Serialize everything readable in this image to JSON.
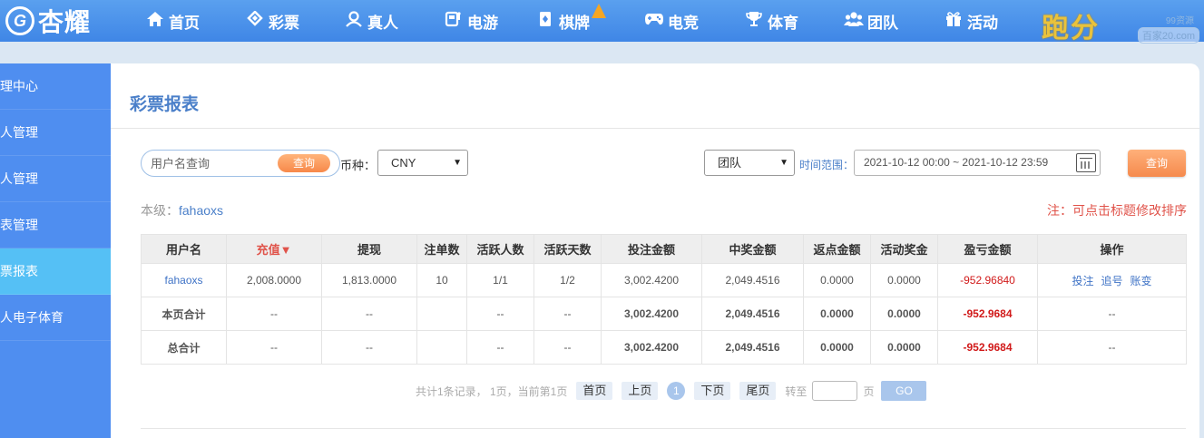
{
  "brand": {
    "logo_mark": "G",
    "logo_text": "杏耀",
    "promo_text": "跑分",
    "watermark_top": "99资源",
    "watermark_bottom": "百家20.com"
  },
  "nav": [
    {
      "label": "首页",
      "icon": "home-icon"
    },
    {
      "label": "彩票",
      "icon": "ticket-icon"
    },
    {
      "label": "真人",
      "icon": "person-icon"
    },
    {
      "label": "电游",
      "icon": "slot-machine-icon"
    },
    {
      "label": "棋牌",
      "icon": "card-icon"
    },
    {
      "label": "电竞",
      "icon": "gamepad-icon"
    },
    {
      "label": "体育",
      "icon": "trophy-icon"
    },
    {
      "label": "团队",
      "icon": "team-icon"
    },
    {
      "label": "活动",
      "icon": "gift-icon"
    }
  ],
  "sidebar": {
    "items": [
      {
        "label": "理中心"
      },
      {
        "label": "人管理"
      },
      {
        "label": "人管理"
      },
      {
        "label": "表管理"
      },
      {
        "label": "票报表"
      },
      {
        "label": "人电子体育"
      }
    ]
  },
  "page": {
    "title": "彩票报表"
  },
  "filters": {
    "search_placeholder": "用户名查询",
    "search_button": "查询",
    "currency_label": "币种：",
    "currency_value": "CNY",
    "scope_value": "团队",
    "time_label": "时间范围：",
    "date_range": "2021-10-12 00:00 ~ 2021-10-12 23:59",
    "query_button": "查询"
  },
  "level": {
    "label": "本级：",
    "name": "fahaoxs"
  },
  "note": "注：可点击标题修改排序",
  "table": {
    "headers": [
      "用户名",
      "充值▼",
      "提现",
      "注单数",
      "活跃人数",
      "活跃天数",
      "投注金额",
      "中奖金额",
      "返点金额",
      "活动奖金",
      "盈亏金额",
      "操作"
    ],
    "row": {
      "user": "fahaoxs",
      "deposit": "2,008.0000",
      "withdraw": "1,813.0000",
      "orders": "10",
      "active_users": "1/1",
      "active_days": "1/2",
      "bet": "3,002.4200",
      "win": "2,049.4516",
      "rebate": "0.0000",
      "bonus": "0.0000",
      "profit": "-952.96840",
      "ops": [
        "投注",
        "追号",
        "账变"
      ]
    },
    "page_total": {
      "label": "本页合计",
      "deposit": "--",
      "withdraw": "--",
      "orders": "",
      "active_users": "--",
      "active_days": "--",
      "bet": "3,002.4200",
      "win": "2,049.4516",
      "rebate": "0.0000",
      "bonus": "0.0000",
      "profit": "-952.9684",
      "ops": "--"
    },
    "grand_total": {
      "label": "总合计",
      "deposit": "--",
      "withdraw": "--",
      "orders": "",
      "active_users": "--",
      "active_days": "--",
      "bet": "3,002.4200",
      "win": "2,049.4516",
      "rebate": "0.0000",
      "bonus": "0.0000",
      "profit": "-952.9684",
      "ops": "--"
    }
  },
  "pager": {
    "summary": "共计1条记录， 1页，当前第1页",
    "first": "首页",
    "prev": "上页",
    "current": "1",
    "next": "下页",
    "last": "尾页",
    "goto_label": "转至",
    "page_unit": "页",
    "go": "GO"
  }
}
